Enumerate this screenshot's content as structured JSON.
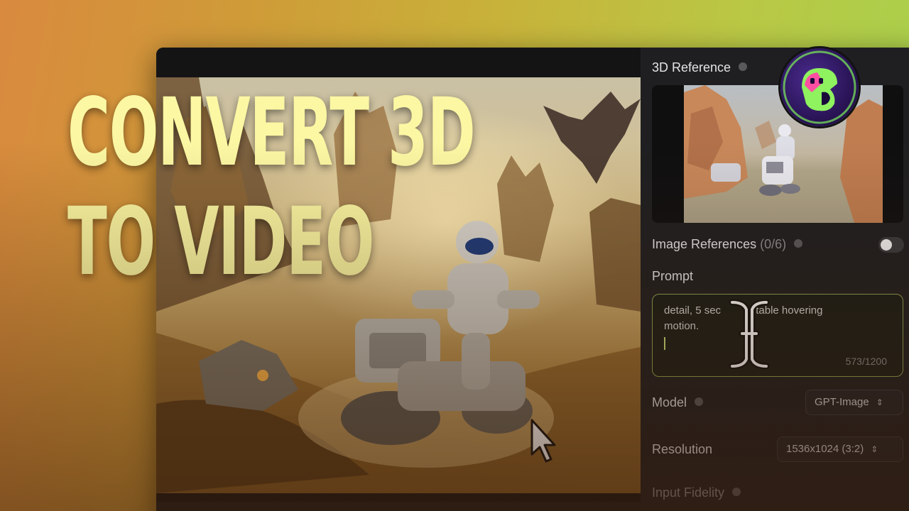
{
  "headline": {
    "line1": "CONVERT 3D",
    "line2": "TO VIDEO"
  },
  "panel": {
    "reference_3d_label": "3D Reference",
    "image_references_label": "Image References",
    "image_references_count": "(0/6)",
    "image_references_enabled": false,
    "prompt_label": "Prompt",
    "prompt_text_line1": "detail, 5 sec",
    "prompt_text_line1b": "f stable hovering",
    "prompt_text_line2": "motion.",
    "prompt_counter": "573/1200",
    "model_label": "Model",
    "model_value": "GPT-Image",
    "resolution_label": "Resolution",
    "resolution_value": "1536x1024 (3:2)",
    "input_fidelity_label": "Input Fidelity"
  },
  "colors": {
    "headline": "#fbf7a3",
    "accent_border": "#8ea653",
    "panel_bg": "#1f1f21"
  },
  "icons": [
    "info-icon",
    "chevron-updown-icon",
    "text-cursor-icon",
    "mouse-pointer-icon",
    "logo-badge"
  ]
}
